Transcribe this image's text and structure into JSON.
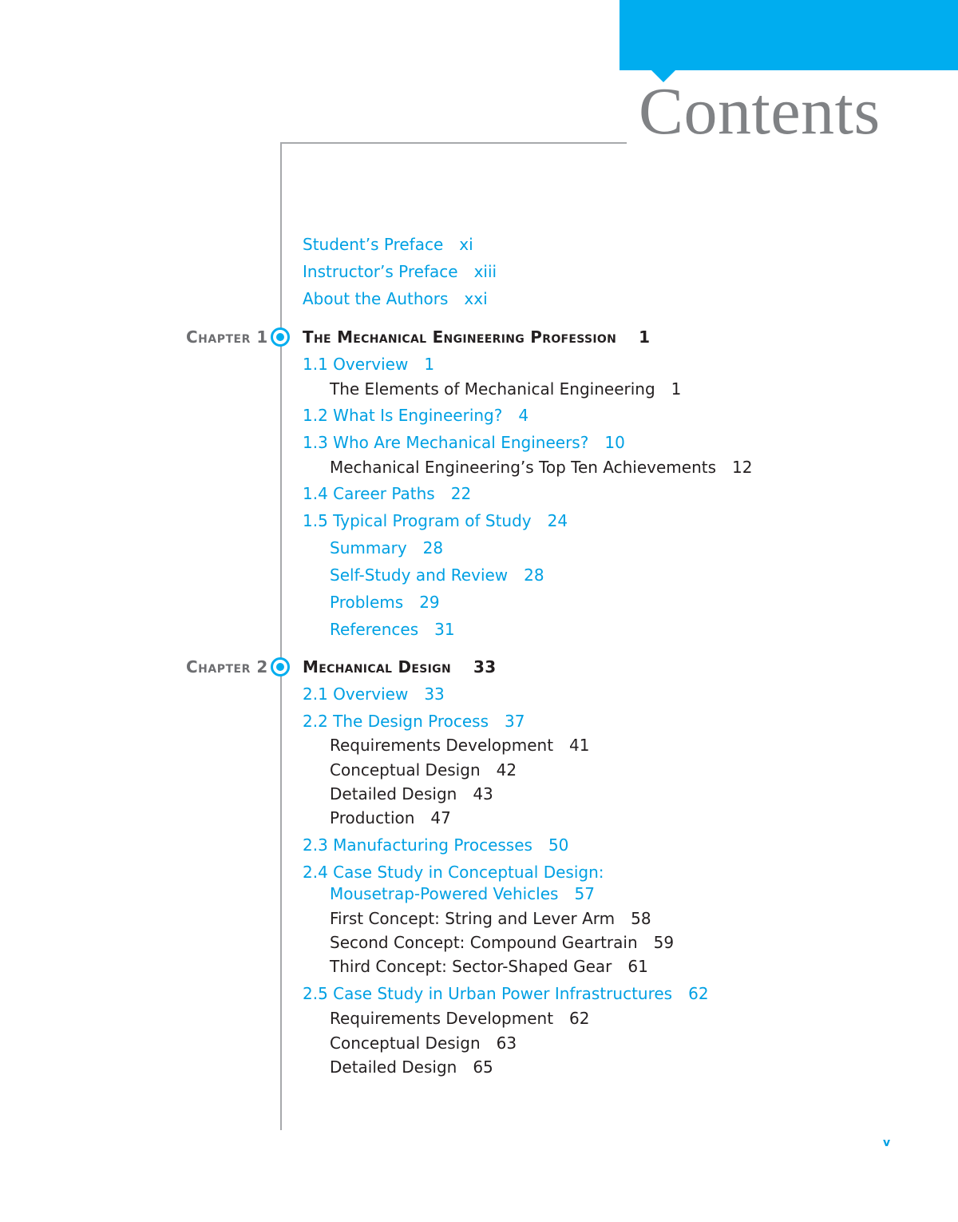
{
  "page": {
    "title": "Contents",
    "folio": "v",
    "accent_color": "#00adef"
  },
  "front_matter": [
    {
      "label": "Student’s Preface",
      "page": "xi"
    },
    {
      "label": "Instructor’s Preface",
      "page": "xiii"
    },
    {
      "label": "About the Authors",
      "page": "xxi"
    }
  ],
  "chapters": [
    {
      "label": "Chapter 1",
      "title": "The Mechanical Engineering Profession",
      "page": "1",
      "entries": [
        {
          "label": "1.1 Overview",
          "page": "1"
        },
        {
          "label": "The Elements of Mechanical Engineering",
          "page": "1"
        },
        {
          "label": "1.2 What Is Engineering?",
          "page": "4"
        },
        {
          "label": "1.3 Who Are Mechanical Engineers?",
          "page": "10"
        },
        {
          "label": "Mechanical Engineering’s Top Ten Achievements",
          "page": "12"
        },
        {
          "label": "1.4 Career Paths",
          "page": "22"
        },
        {
          "label": "1.5 Typical Program of Study",
          "page": "24"
        },
        {
          "label": "Summary",
          "page": "28"
        },
        {
          "label": "Self-Study and Review",
          "page": "28"
        },
        {
          "label": "Problems",
          "page": "29"
        },
        {
          "label": "References",
          "page": "31"
        }
      ]
    },
    {
      "label": "Chapter 2",
      "title": "Mechanical Design",
      "page": "33",
      "entries": [
        {
          "label": "2.1 Overview",
          "page": "33"
        },
        {
          "label": "2.2 The Design Process",
          "page": "37"
        },
        {
          "label": "Requirements Development",
          "page": "41"
        },
        {
          "label": "Conceptual Design",
          "page": "42"
        },
        {
          "label": "Detailed Design",
          "page": "43"
        },
        {
          "label": "Production",
          "page": "47"
        },
        {
          "label": "2.3 Manufacturing Processes",
          "page": "50"
        },
        {
          "label": "2.4 Case Study in Conceptual Design:",
          "page": ""
        },
        {
          "label": "Mousetrap-Powered Vehicles",
          "page": "57"
        },
        {
          "label": "First Concept: String and Lever Arm",
          "page": "58"
        },
        {
          "label": "Second Concept: Compound Geartrain",
          "page": "59"
        },
        {
          "label": "Third Concept: Sector-Shaped Gear",
          "page": "61"
        },
        {
          "label": "2.5 Case Study in Urban Power Infrastructures",
          "page": "62"
        },
        {
          "label": "Requirements Development",
          "page": "62"
        },
        {
          "label": "Conceptual Design",
          "page": "63"
        },
        {
          "label": "Detailed Design",
          "page": "65"
        }
      ]
    }
  ]
}
